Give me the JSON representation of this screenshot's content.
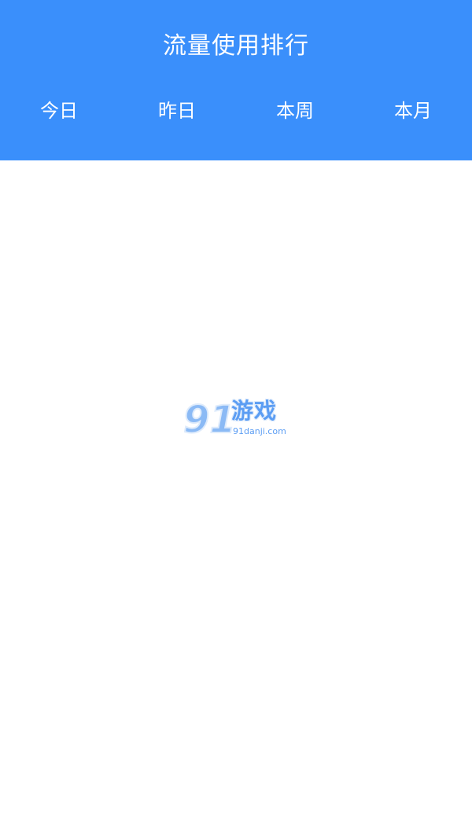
{
  "header": {
    "title": "流量使用排行",
    "background_color": "#3a8ffb",
    "text_color": "#ffffff"
  },
  "tabs": [
    {
      "label": "今日"
    },
    {
      "label": "昨日"
    },
    {
      "label": "本周"
    },
    {
      "label": "本月"
    }
  ],
  "watermark": {
    "mark_text": "91",
    "name": "游戏",
    "url": "91danji.com",
    "color": "#4a93f2"
  }
}
